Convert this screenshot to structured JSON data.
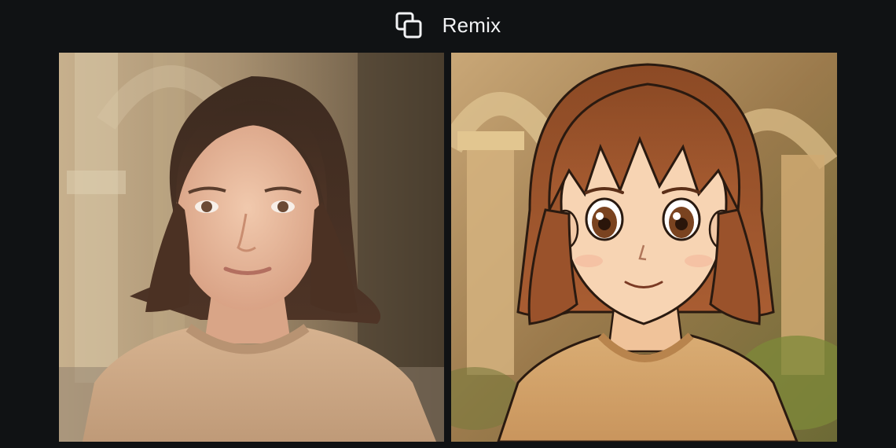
{
  "header": {
    "icon": "remix-icon",
    "label": "Remix"
  },
  "images": [
    {
      "name": "original-photo",
      "icon": "photo-portrait"
    },
    {
      "name": "remixed-anime",
      "icon": "anime-portrait"
    }
  ],
  "colors": {
    "background": "#101214",
    "text": "#f2f3f5"
  }
}
